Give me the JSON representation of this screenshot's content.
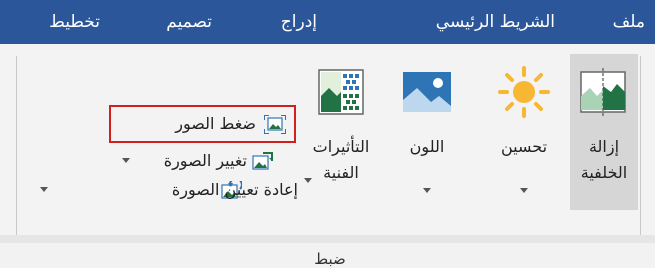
{
  "tabs": [
    {
      "id": "file",
      "label": "ملف"
    },
    {
      "id": "home",
      "label": "الشريط الرئيسي"
    },
    {
      "id": "insert",
      "label": "إدراج"
    },
    {
      "id": "design",
      "label": "تصميم"
    },
    {
      "id": "layout",
      "label": "تخطيط"
    }
  ],
  "adjust_group": {
    "label": "ضبط",
    "remove_background": {
      "line1": "إزالة",
      "line2": "الخلفية"
    },
    "corrections": {
      "label": "تحسين"
    },
    "color": {
      "label": "اللون"
    },
    "artistic_effects": {
      "line1": "التأثيرات",
      "line2": "الفنية"
    },
    "compress_pictures": {
      "label": "ضغط الصور"
    },
    "change_picture": {
      "label": "تغيير الصورة"
    },
    "reset_picture": {
      "label": "إعادة تعيين الصورة"
    }
  },
  "colors": {
    "tab_bar": "#2b579a",
    "highlight_border": "#d21f1f",
    "selected_button": "#d6d6d6"
  }
}
